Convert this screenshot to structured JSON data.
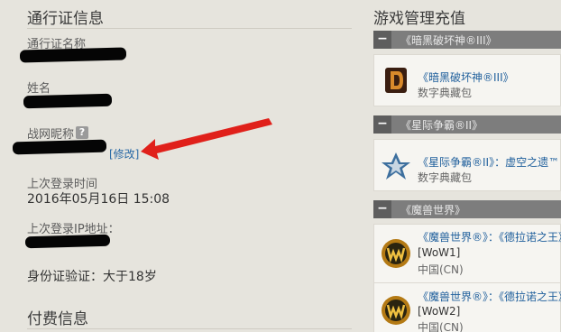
{
  "account": {
    "section_title": "通行证信息",
    "passport_name_label": "通行证名称",
    "surname_label": "姓名",
    "nickname_label": "战网昵称",
    "help_mark": "?",
    "edit_link": "[修改]",
    "last_login_label": "上次登录时间",
    "last_login_value": "2016年05月16日 15:08",
    "last_ip_label": "上次登录IP地址：",
    "id_verify": "身份证验证：大于18岁"
  },
  "billing": {
    "section_title": "付费信息"
  },
  "games": {
    "section_title": "游戏管理充值",
    "groups": [
      {
        "header": "《暗黑破坏神®III》",
        "entries": [
          {
            "name": "《暗黑破坏神®III》",
            "sub": "数字典藏包",
            "icon": "diablo-icon"
          }
        ]
      },
      {
        "header": "《星际争霸®II》",
        "entries": [
          {
            "name": "《星际争霸®II》：虚空之遗™",
            "sub": "数字典藏包",
            "icon": "starcraft-icon"
          }
        ]
      },
      {
        "header": "《魔兽世界》",
        "entries": [
          {
            "name": "《魔兽世界®》：《德拉诺之王》",
            "account": "[WoW1]",
            "region": "中国(CN)",
            "icon": "wow-icon"
          },
          {
            "name": "《魔兽世界®》：《德拉诺之王》",
            "account": "[WoW2]",
            "region": "中国(CN)",
            "icon": "wow-icon"
          }
        ]
      }
    ]
  },
  "colors": {
    "background": "#e6e4dd",
    "group_bar": "#7d7d7d",
    "link": "#1f5f9c",
    "arrow": "#e0201a"
  }
}
